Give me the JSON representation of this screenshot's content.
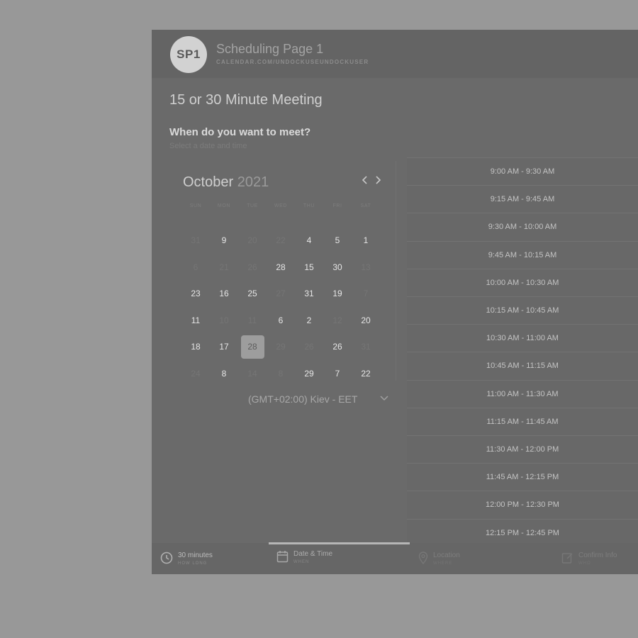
{
  "header": {
    "avatar": "SP1",
    "page_name": "Scheduling Page 1",
    "url": "CALENDAR.COM/UNDOCKUSEUNDOCKUSER"
  },
  "event": {
    "title": "15 or 30 Minute Meeting",
    "question": "When do you want to meet?",
    "subtitle": "Select a date and time"
  },
  "calendar": {
    "month": "October",
    "year": "2021",
    "weekdays": [
      "SUN",
      "MON",
      "TUE",
      "WED",
      "THU",
      "FRI",
      "SAT"
    ],
    "weeks": [
      [
        {
          "d": "31",
          "m": true
        },
        {
          "d": "9",
          "m": false
        },
        {
          "d": "20",
          "m": true
        },
        {
          "d": "22",
          "m": true
        },
        {
          "d": "4",
          "m": false
        },
        {
          "d": "5",
          "m": false
        },
        {
          "d": "1",
          "m": false
        }
      ],
      [
        {
          "d": "6",
          "m": true
        },
        {
          "d": "21",
          "m": true
        },
        {
          "d": "26",
          "m": true
        },
        {
          "d": "28",
          "m": false
        },
        {
          "d": "15",
          "m": false
        },
        {
          "d": "30",
          "m": false
        },
        {
          "d": "13",
          "m": true
        }
      ],
      [
        {
          "d": "23",
          "m": false
        },
        {
          "d": "16",
          "m": false
        },
        {
          "d": "25",
          "m": false
        },
        {
          "d": "27",
          "m": true
        },
        {
          "d": "31",
          "m": false
        },
        {
          "d": "19",
          "m": false
        },
        {
          "d": "7",
          "m": true
        }
      ],
      [
        {
          "d": "11",
          "m": false
        },
        {
          "d": "10",
          "m": true
        },
        {
          "d": "11",
          "m": true
        },
        {
          "d": "6",
          "m": false
        },
        {
          "d": "2",
          "m": false
        },
        {
          "d": "12",
          "m": true
        },
        {
          "d": "20",
          "m": false
        }
      ],
      [
        {
          "d": "18",
          "m": false
        },
        {
          "d": "17",
          "m": false
        },
        {
          "d": "28",
          "m": false,
          "s": true
        },
        {
          "d": "29",
          "m": true
        },
        {
          "d": "26",
          "m": true
        },
        {
          "d": "26",
          "m": false
        },
        {
          "d": "31",
          "m": true
        }
      ],
      [
        {
          "d": "24",
          "m": true
        },
        {
          "d": "8",
          "m": false
        },
        {
          "d": "14",
          "m": true
        },
        {
          "d": "8",
          "m": true
        },
        {
          "d": "29",
          "m": false
        },
        {
          "d": "7",
          "m": false
        },
        {
          "d": "22",
          "m": false
        }
      ]
    ],
    "timezone": "(GMT+02:00) Kiev - EET"
  },
  "slots": [
    "9:00 AM - 9:30 AM",
    "9:15 AM - 9:45 AM",
    "9:30 AM - 10:00 AM",
    "9:45 AM - 10:15 AM",
    "10:00 AM - 10:30 AM",
    "10:15 AM - 10:45 AM",
    "10:30 AM - 11:00 AM",
    "10:45 AM - 11:15 AM",
    "11:00 AM - 11:30 AM",
    "11:15 AM - 11:45 AM",
    "11:30 AM - 12:00 PM",
    "11:45 AM - 12:15 PM",
    "12:00 PM - 12:30 PM",
    "12:15 PM - 12:45 PM"
  ],
  "footer": {
    "steps": [
      {
        "label": "30 minutes",
        "sub": "HOW LONG",
        "icon": "clock-icon"
      },
      {
        "label": "Date & Time",
        "sub": "WHEN",
        "icon": "calendar-icon"
      },
      {
        "label": "Location",
        "sub": "WHERE",
        "icon": "location-pin-icon"
      },
      {
        "label": "Confirm Info",
        "sub": "WHO",
        "icon": "edit-icon"
      }
    ]
  },
  "colors": {
    "page_bg": "#989898",
    "panel_bg": "#6a6a6a",
    "selected_day_bg": "#9d9d9d"
  }
}
